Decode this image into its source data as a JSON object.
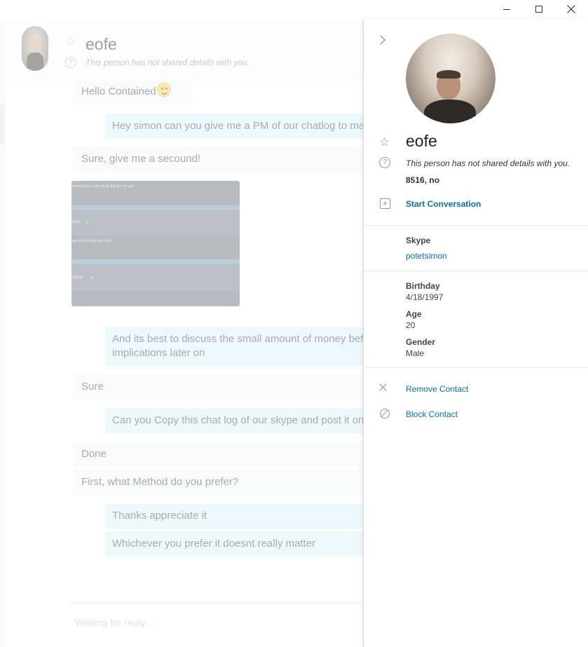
{
  "window": {
    "minimize_icon": "minimize-icon",
    "maximize_icon": "maximize-icon",
    "close_icon": "close-icon"
  },
  "chat": {
    "header": {
      "name": "eofe",
      "subtitle": "This person has not shared details with you."
    },
    "messages": [
      {
        "dir": "in",
        "text": "Hello Contained"
      },
      {
        "dir": "out",
        "text": "Hey simon can you give me a PM of our chatlog to ma"
      },
      {
        "dir": "in",
        "text": "Sure, give me a secound!"
      },
      {
        "dir": "in",
        "type": "image"
      },
      {
        "dir": "out",
        "text": "And its best to discuss the small amount of money bef implications later on"
      },
      {
        "dir": "in",
        "text": "Sure"
      },
      {
        "dir": "out",
        "text": "Can you Copy this chat log of our skype and post it on"
      },
      {
        "dir": "in",
        "text": "Done"
      },
      {
        "dir": "in",
        "text": "First, what Method do you prefer?"
      },
      {
        "dir": "out",
        "text": "Thanks appreciate it"
      },
      {
        "dir": "out",
        "text": "Whichever you prefer it doesnt really matter"
      }
    ],
    "image_preview": {
      "line1": "a second so I can set up the acc for you!",
      "line2": "ained",
      "line3": "ater to talk there and such!",
      "line4": "Canifia"
    },
    "composer_placeholder": "Waiting for reply..."
  },
  "profile": {
    "name": "eofe",
    "subtitle": "This person has not shared details with you.",
    "location": "8516, no",
    "start_conversation": "Start Conversation",
    "skype_label": "Skype",
    "skype_value": "potetsimon",
    "birthday_label": "Birthday",
    "birthday_value": "4/18/1997",
    "age_label": "Age",
    "age_value": "20",
    "gender_label": "Gender",
    "gender_value": "Male",
    "remove_contact": "Remove Contact",
    "block_contact": "Block Contact"
  },
  "colors": {
    "accent": "#0a6fa8",
    "outgoing_bubble": "#d7f0fb",
    "incoming_bubble": "#f1f3f5"
  }
}
